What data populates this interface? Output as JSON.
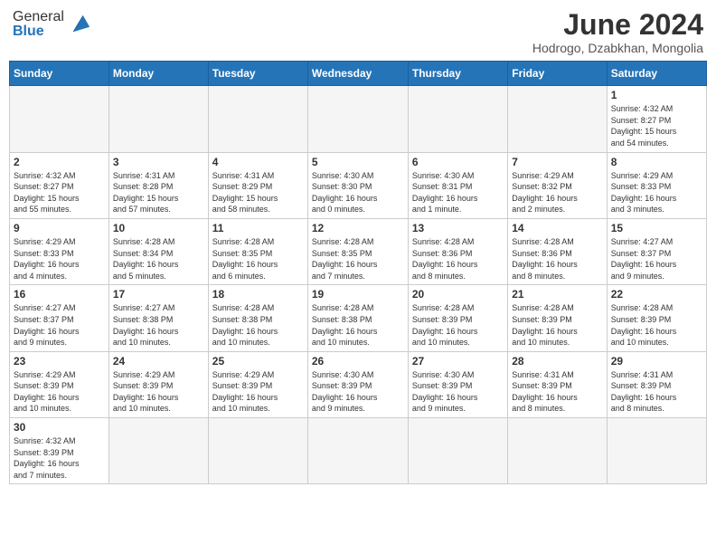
{
  "header": {
    "logo_general": "General",
    "logo_blue": "Blue",
    "month_title": "June 2024",
    "location": "Hodrogo, Dzabkhan, Mongolia"
  },
  "weekdays": [
    "Sunday",
    "Monday",
    "Tuesday",
    "Wednesday",
    "Thursday",
    "Friday",
    "Saturday"
  ],
  "weeks": [
    [
      {
        "day": "",
        "info": ""
      },
      {
        "day": "",
        "info": ""
      },
      {
        "day": "",
        "info": ""
      },
      {
        "day": "",
        "info": ""
      },
      {
        "day": "",
        "info": ""
      },
      {
        "day": "",
        "info": ""
      },
      {
        "day": "1",
        "info": "Sunrise: 4:32 AM\nSunset: 8:27 PM\nDaylight: 15 hours\nand 54 minutes."
      }
    ],
    [
      {
        "day": "2",
        "info": "Sunrise: 4:32 AM\nSunset: 8:27 PM\nDaylight: 15 hours\nand 55 minutes."
      },
      {
        "day": "3",
        "info": "Sunrise: 4:31 AM\nSunset: 8:28 PM\nDaylight: 15 hours\nand 57 minutes."
      },
      {
        "day": "4",
        "info": "Sunrise: 4:31 AM\nSunset: 8:29 PM\nDaylight: 15 hours\nand 58 minutes."
      },
      {
        "day": "5",
        "info": "Sunrise: 4:30 AM\nSunset: 8:30 PM\nDaylight: 16 hours\nand 0 minutes."
      },
      {
        "day": "6",
        "info": "Sunrise: 4:30 AM\nSunset: 8:31 PM\nDaylight: 16 hours\nand 1 minute."
      },
      {
        "day": "7",
        "info": "Sunrise: 4:29 AM\nSunset: 8:32 PM\nDaylight: 16 hours\nand 2 minutes."
      },
      {
        "day": "8",
        "info": "Sunrise: 4:29 AM\nSunset: 8:33 PM\nDaylight: 16 hours\nand 3 minutes."
      }
    ],
    [
      {
        "day": "9",
        "info": "Sunrise: 4:29 AM\nSunset: 8:33 PM\nDaylight: 16 hours\nand 4 minutes."
      },
      {
        "day": "10",
        "info": "Sunrise: 4:28 AM\nSunset: 8:34 PM\nDaylight: 16 hours\nand 5 minutes."
      },
      {
        "day": "11",
        "info": "Sunrise: 4:28 AM\nSunset: 8:35 PM\nDaylight: 16 hours\nand 6 minutes."
      },
      {
        "day": "12",
        "info": "Sunrise: 4:28 AM\nSunset: 8:35 PM\nDaylight: 16 hours\nand 7 minutes."
      },
      {
        "day": "13",
        "info": "Sunrise: 4:28 AM\nSunset: 8:36 PM\nDaylight: 16 hours\nand 8 minutes."
      },
      {
        "day": "14",
        "info": "Sunrise: 4:28 AM\nSunset: 8:36 PM\nDaylight: 16 hours\nand 8 minutes."
      },
      {
        "day": "15",
        "info": "Sunrise: 4:27 AM\nSunset: 8:37 PM\nDaylight: 16 hours\nand 9 minutes."
      }
    ],
    [
      {
        "day": "16",
        "info": "Sunrise: 4:27 AM\nSunset: 8:37 PM\nDaylight: 16 hours\nand 9 minutes."
      },
      {
        "day": "17",
        "info": "Sunrise: 4:27 AM\nSunset: 8:38 PM\nDaylight: 16 hours\nand 10 minutes."
      },
      {
        "day": "18",
        "info": "Sunrise: 4:28 AM\nSunset: 8:38 PM\nDaylight: 16 hours\nand 10 minutes."
      },
      {
        "day": "19",
        "info": "Sunrise: 4:28 AM\nSunset: 8:38 PM\nDaylight: 16 hours\nand 10 minutes."
      },
      {
        "day": "20",
        "info": "Sunrise: 4:28 AM\nSunset: 8:39 PM\nDaylight: 16 hours\nand 10 minutes."
      },
      {
        "day": "21",
        "info": "Sunrise: 4:28 AM\nSunset: 8:39 PM\nDaylight: 16 hours\nand 10 minutes."
      },
      {
        "day": "22",
        "info": "Sunrise: 4:28 AM\nSunset: 8:39 PM\nDaylight: 16 hours\nand 10 minutes."
      }
    ],
    [
      {
        "day": "23",
        "info": "Sunrise: 4:29 AM\nSunset: 8:39 PM\nDaylight: 16 hours\nand 10 minutes."
      },
      {
        "day": "24",
        "info": "Sunrise: 4:29 AM\nSunset: 8:39 PM\nDaylight: 16 hours\nand 10 minutes."
      },
      {
        "day": "25",
        "info": "Sunrise: 4:29 AM\nSunset: 8:39 PM\nDaylight: 16 hours\nand 10 minutes."
      },
      {
        "day": "26",
        "info": "Sunrise: 4:30 AM\nSunset: 8:39 PM\nDaylight: 16 hours\nand 9 minutes."
      },
      {
        "day": "27",
        "info": "Sunrise: 4:30 AM\nSunset: 8:39 PM\nDaylight: 16 hours\nand 9 minutes."
      },
      {
        "day": "28",
        "info": "Sunrise: 4:31 AM\nSunset: 8:39 PM\nDaylight: 16 hours\nand 8 minutes."
      },
      {
        "day": "29",
        "info": "Sunrise: 4:31 AM\nSunset: 8:39 PM\nDaylight: 16 hours\nand 8 minutes."
      }
    ],
    [
      {
        "day": "30",
        "info": "Sunrise: 4:32 AM\nSunset: 8:39 PM\nDaylight: 16 hours\nand 7 minutes."
      },
      {
        "day": "",
        "info": ""
      },
      {
        "day": "",
        "info": ""
      },
      {
        "day": "",
        "info": ""
      },
      {
        "day": "",
        "info": ""
      },
      {
        "day": "",
        "info": ""
      },
      {
        "day": "",
        "info": ""
      }
    ]
  ]
}
